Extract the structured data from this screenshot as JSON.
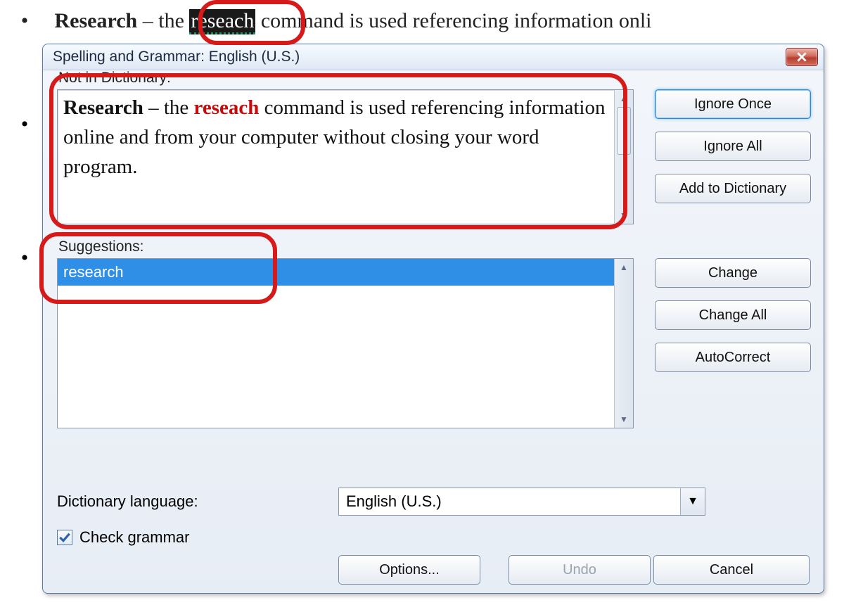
{
  "document": {
    "bullet_glyph": "•",
    "line_bold": "Research",
    "line_sep": " – ",
    "line_before_error": "the ",
    "line_error": "reseach",
    "line_after_error": " command is used referencing information onli"
  },
  "dialog": {
    "title": "Spelling and Grammar: English (U.S.)",
    "not_in_dict_label": "Not in Dictionary:",
    "sentence_bold": "Research",
    "sentence_sep": " – ",
    "sentence_before": "the ",
    "sentence_error": "reseach",
    "sentence_after": " command is used referencing information online and from your computer without closing your word program.",
    "suggestions_label": "Suggestions:",
    "suggestions": [
      "research"
    ],
    "dictionary_language_label": "Dictionary language:",
    "dictionary_language_value": "English (U.S.)",
    "check_grammar_label": "Check grammar",
    "check_grammar_checked": true,
    "buttons": {
      "ignore_once": "Ignore Once",
      "ignore_all": "Ignore All",
      "add_to_dictionary": "Add to Dictionary",
      "change": "Change",
      "change_all": "Change All",
      "autocorrect": "AutoCorrect",
      "options": "Options...",
      "undo": "Undo",
      "cancel": "Cancel"
    }
  }
}
